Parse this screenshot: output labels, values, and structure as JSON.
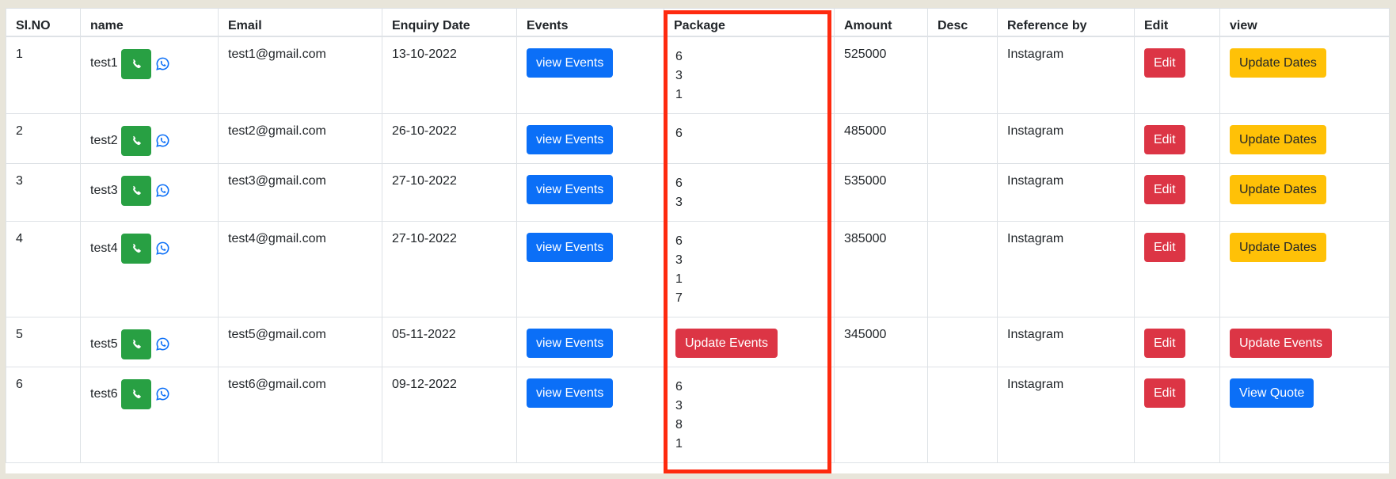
{
  "table": {
    "headers": [
      "Sl.NO",
      "name",
      "Email",
      "Enquiry Date",
      "Events",
      "Package",
      "Amount",
      "Desc",
      "Reference by",
      "Edit",
      "view"
    ],
    "rows": [
      {
        "sl_no": "1",
        "name": "test1",
        "email": "test1@gmail.com",
        "enquiry_date": "13-10-2022",
        "events_button": "view Events",
        "package": [
          "6",
          "3",
          "1"
        ],
        "package_button": null,
        "amount": "525000",
        "desc": "",
        "reference_by": "Instagram",
        "edit_button": "Edit",
        "view_button": "Update Dates",
        "view_button_style": "warning"
      },
      {
        "sl_no": "2",
        "name": "test2",
        "email": "test2@gmail.com",
        "enquiry_date": "26-10-2022",
        "events_button": "view Events",
        "package": [
          "6"
        ],
        "package_button": null,
        "amount": "485000",
        "desc": "",
        "reference_by": "Instagram",
        "edit_button": "Edit",
        "view_button": "Update Dates",
        "view_button_style": "warning"
      },
      {
        "sl_no": "3",
        "name": "test3",
        "email": "test3@gmail.com",
        "enquiry_date": "27-10-2022",
        "events_button": "view Events",
        "package": [
          "6",
          "3"
        ],
        "package_button": null,
        "amount": "535000",
        "desc": "",
        "reference_by": "Instagram",
        "edit_button": "Edit",
        "view_button": "Update Dates",
        "view_button_style": "warning"
      },
      {
        "sl_no": "4",
        "name": "test4",
        "email": "test4@gmail.com",
        "enquiry_date": "27-10-2022",
        "events_button": "view Events",
        "package": [
          "6",
          "3",
          "1",
          "7"
        ],
        "package_button": null,
        "amount": "385000",
        "desc": "",
        "reference_by": "Instagram",
        "edit_button": "Edit",
        "view_button": "Update Dates",
        "view_button_style": "warning"
      },
      {
        "sl_no": "5",
        "name": "test5",
        "email": "test5@gmail.com",
        "enquiry_date": "05-11-2022",
        "events_button": "view Events",
        "package": [],
        "package_button": "Update Events",
        "amount": "345000",
        "desc": "",
        "reference_by": "Instagram",
        "edit_button": "Edit",
        "view_button": "Update Events",
        "view_button_style": "danger"
      },
      {
        "sl_no": "6",
        "name": "test6",
        "email": "test6@gmail.com",
        "enquiry_date": "09-12-2022",
        "events_button": "view Events",
        "package": [
          "6",
          "3",
          "8",
          "1"
        ],
        "package_button": null,
        "amount": "",
        "desc": "",
        "reference_by": "Instagram",
        "edit_button": "Edit",
        "view_button": "View Quote",
        "view_button_style": "primary"
      }
    ]
  },
  "icons": {
    "call": "phone-icon",
    "whatsapp": "whatsapp-icon"
  },
  "colors": {
    "primary": "#0b6ff7",
    "danger": "#dc3545",
    "warning": "#ffc107",
    "success": "#28a043",
    "highlight": "#fe2a0f",
    "background": "#e8e5da"
  }
}
